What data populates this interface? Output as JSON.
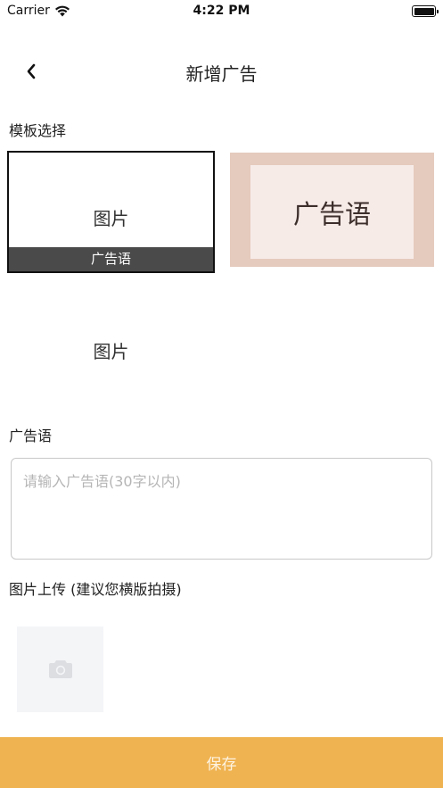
{
  "status_bar": {
    "carrier": "Carrier",
    "time": "4:22 PM",
    "wifi_icon": "wifi-icon",
    "battery_icon": "battery-icon"
  },
  "nav": {
    "back_icon": "chevron-left-icon",
    "title": "新增广告"
  },
  "template_section": {
    "label": "模板选择",
    "templates": [
      {
        "image_text": "图片",
        "caption": "广告语",
        "selected": true
      },
      {
        "text": "广告语",
        "bg_color": "#e5cbbd",
        "inner_color": "#f7ebe8"
      },
      {
        "image_text": "图片"
      }
    ]
  },
  "ad_text_section": {
    "label": "广告语",
    "value": "",
    "placeholder": "请输入广告语(30字以内)"
  },
  "upload_section": {
    "label": "图片上传 (建议您横版拍摄)",
    "icon": "camera-icon"
  },
  "save_button": {
    "label": "保存",
    "color": "#f0b351"
  }
}
